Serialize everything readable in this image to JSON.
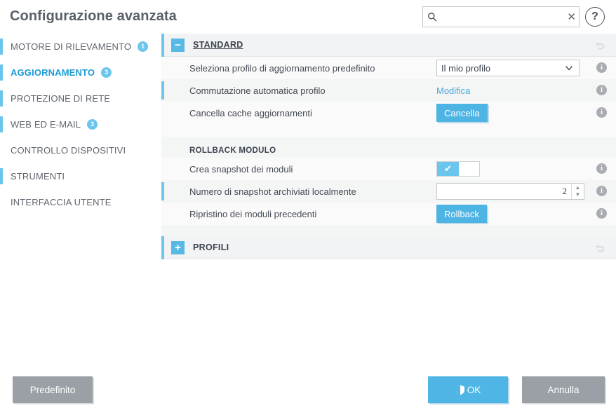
{
  "header": {
    "title": "Configurazione avanzata",
    "search": {
      "value": "",
      "placeholder": "",
      "clear_label": "✕",
      "icon": "search-icon"
    },
    "help_label": "?"
  },
  "sidebar": {
    "items": [
      {
        "label": "MOTORE DI RILEVAMENTO",
        "badge": "1",
        "active": false,
        "marker": true
      },
      {
        "label": "AGGIORNAMENTO",
        "badge": "3",
        "active": true,
        "marker": true
      },
      {
        "label": "PROTEZIONE DI RETE",
        "badge": "",
        "active": false,
        "marker": true
      },
      {
        "label": "WEB ED E-MAIL",
        "badge": "3",
        "active": false,
        "marker": true
      },
      {
        "label": "CONTROLLO DISPOSITIVI",
        "badge": "",
        "active": false,
        "marker": false
      },
      {
        "label": "STRUMENTI",
        "badge": "",
        "active": false,
        "marker": true
      },
      {
        "label": "INTERFACCIA UTENTE",
        "badge": "",
        "active": false,
        "marker": false
      }
    ]
  },
  "content": {
    "standard": {
      "expander": "−",
      "title": "STANDARD",
      "rows": [
        {
          "label": "Seleziona profilo di aggiornamento predefinito",
          "control": "select",
          "value": "Il mio profilo",
          "info": "i"
        },
        {
          "label": "Commutazione automatica profilo",
          "control": "link",
          "value": "Modifica",
          "info": "i"
        },
        {
          "label": "Cancella cache aggiornamenti",
          "control": "button",
          "value": "Cancella",
          "info": "i"
        }
      ]
    },
    "rollback": {
      "title": "ROLLBACK MODULO",
      "rows": [
        {
          "label": "Crea snapshot dei moduli",
          "control": "toggle",
          "value": "✔",
          "info": "i"
        },
        {
          "label": "Numero di snapshot archiviati localmente",
          "control": "spinner",
          "value": "2",
          "info": "i"
        },
        {
          "label": "Ripristino dei moduli precedenti",
          "control": "button",
          "value": "Rollback",
          "info": "i"
        }
      ]
    },
    "profili": {
      "expander": "+",
      "title": "PROFILI"
    }
  },
  "footer": {
    "default_label": "Predefinito",
    "ok_label": "OK",
    "cancel_label": "Annulla"
  }
}
